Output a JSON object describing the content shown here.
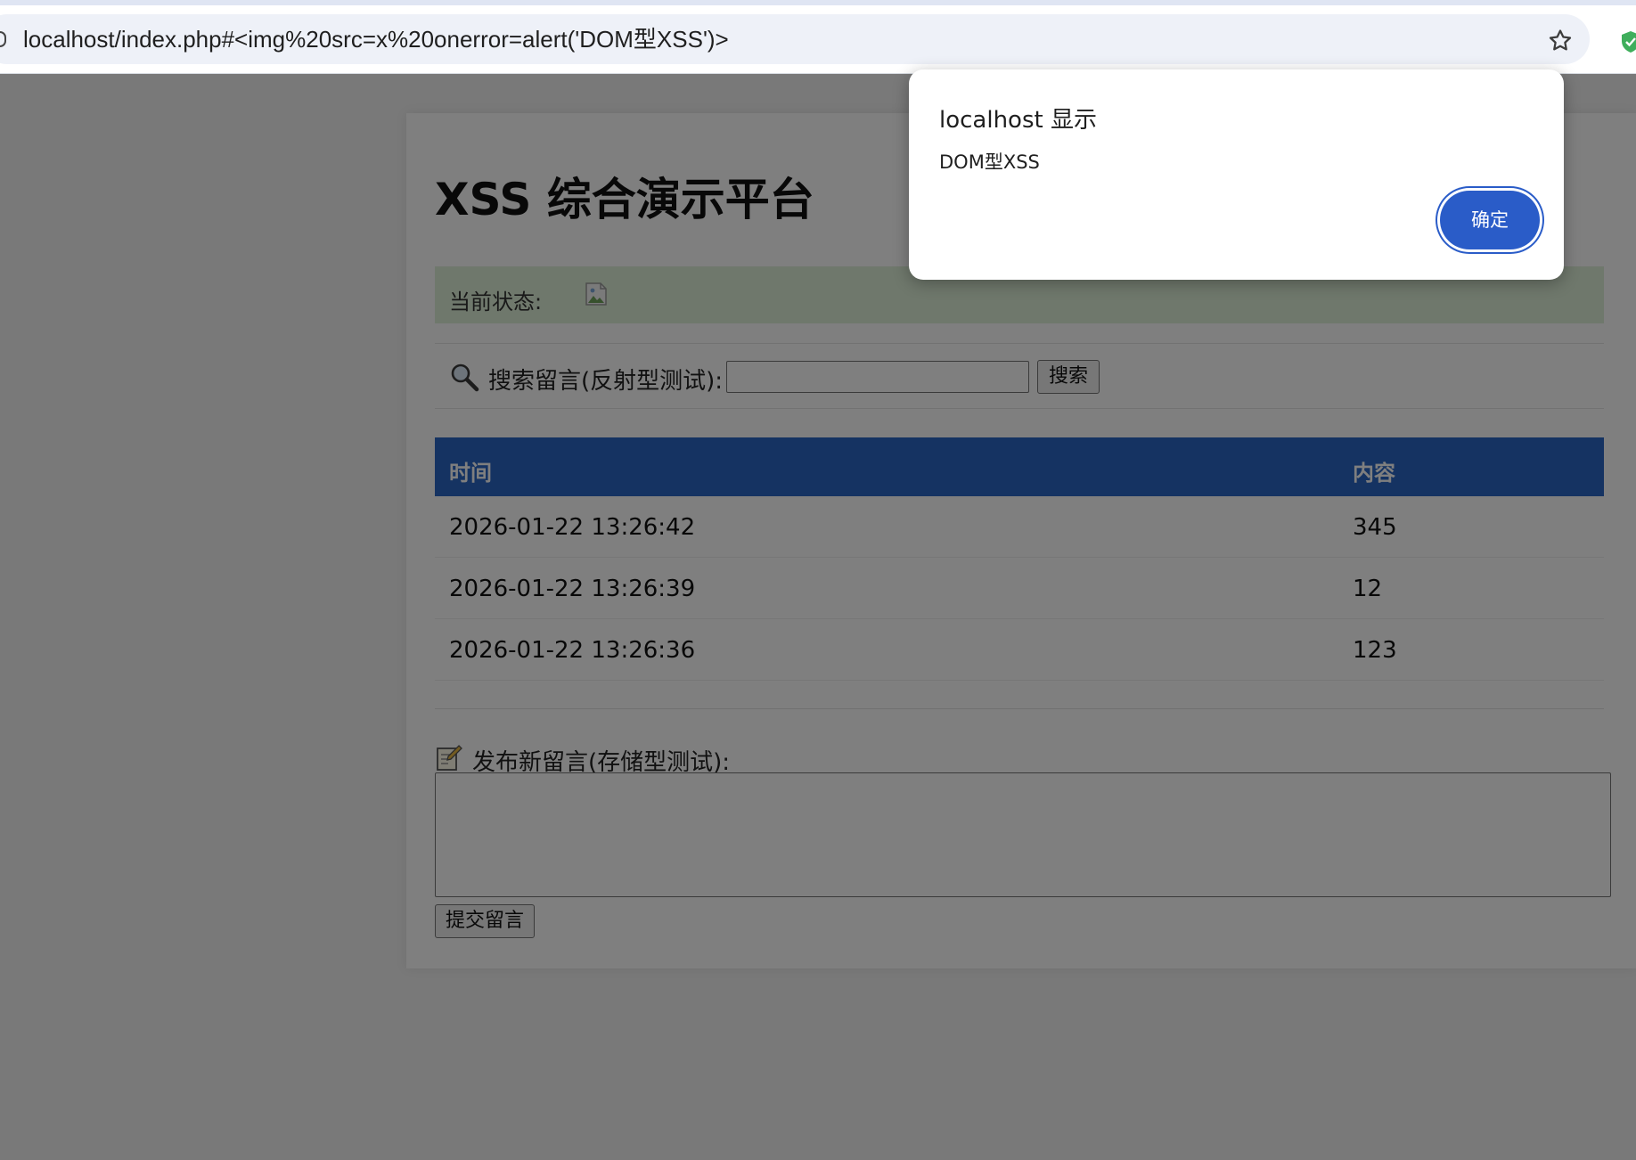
{
  "browser": {
    "url": "localhost/index.php#<img%20src=x%20onerror=alert('DOM型XSS')>",
    "bookmark_icon": "star-icon",
    "extension_icon": "shield-icon"
  },
  "page": {
    "title": "XSS 综合演示平台",
    "status": {
      "label": "当前状态:",
      "icon": "broken-image-icon"
    },
    "search": {
      "icon": "magnifier-icon",
      "label": "搜索留言(反射型测试):",
      "input_value": "",
      "button_label": "搜索"
    },
    "table": {
      "columns": [
        "时间",
        "内容"
      ],
      "rows": [
        {
          "time": "2026-01-22 13:26:42",
          "content": "345"
        },
        {
          "time": "2026-01-22 13:26:39",
          "content": "12"
        },
        {
          "time": "2026-01-22 13:26:36",
          "content": "123"
        }
      ]
    },
    "post": {
      "icon": "memo-icon",
      "label": "发布新留言(存储型测试):",
      "textarea_value": "",
      "submit_label": "提交留言"
    }
  },
  "alert": {
    "title": "localhost 显示",
    "message": "DOM型XSS",
    "ok_label": "确定"
  },
  "colors": {
    "table_header": "#2b67c5",
    "status_bg": "#dff0d8",
    "dialog_button": "#2a5cc8"
  }
}
